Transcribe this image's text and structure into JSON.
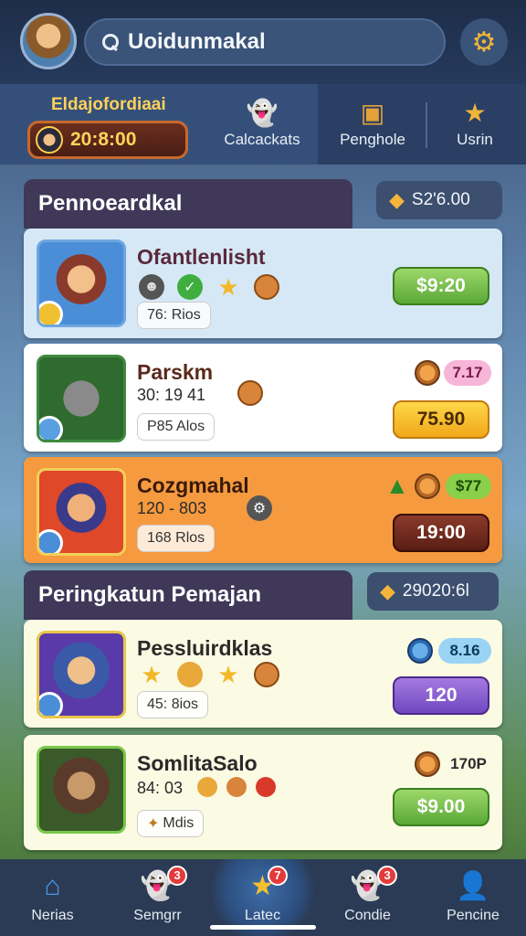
{
  "header": {
    "search_text": "Uoidunmakal",
    "avatar_icon": "avatar-icon",
    "settings_icon": "gear-icon"
  },
  "stats": {
    "label": "Eldajofordiaai",
    "coin_value": "20:8:00",
    "tabs": [
      {
        "label": "Calcackats",
        "icon": "ghost-icon"
      },
      {
        "label": "Penghole",
        "icon": "chest-icon"
      },
      {
        "label": "Usrin",
        "icon": "star-icon"
      }
    ]
  },
  "section1": {
    "title": "Pennoeardkal",
    "pill_value": "S2'6.00"
  },
  "section2": {
    "title": "Peringkatun Pemajan",
    "pill_value": "29020:6l"
  },
  "cards": [
    {
      "title": "Ofantlenlisht",
      "tag": "76: Rios",
      "price": "$9:20",
      "bg": "#d6e8f6",
      "btn": "#79c24a"
    },
    {
      "title": "Parskm",
      "sub": "30: 19   41",
      "tag": "P85 Alos",
      "price": "75.90",
      "chip": "7.17",
      "bg": "#ffffff",
      "btn": "#f4c030"
    },
    {
      "title": "Cozgmahal",
      "sub": "120 - 803",
      "tag": "168 Rlos",
      "price": "19:00",
      "chip": "$77",
      "bg": "#f59a3f",
      "btn": "#7a2a1e"
    },
    {
      "title": "Pessluirdklas",
      "tag": "45: 8ios",
      "price": "120",
      "chip": "8.16",
      "bg": "#fbfae3",
      "btn": "#8a5cd0"
    },
    {
      "title": "SomlitaSalo",
      "sub": "84: 03",
      "tag": "Mdis",
      "price": "$9.00",
      "chip": "170P",
      "bg": "#fbfae3",
      "btn": "#79c24a"
    }
  ],
  "nav": [
    {
      "label": "Nerias",
      "icon": "home-icon"
    },
    {
      "label": "Semgrr",
      "icon": "ghost-icon",
      "badge": "3"
    },
    {
      "label": "Latec",
      "icon": "star-icon",
      "badge": "7"
    },
    {
      "label": "Condie",
      "icon": "ghost-icon",
      "badge": "3"
    },
    {
      "label": "Pencine",
      "icon": "profile-icon"
    }
  ]
}
